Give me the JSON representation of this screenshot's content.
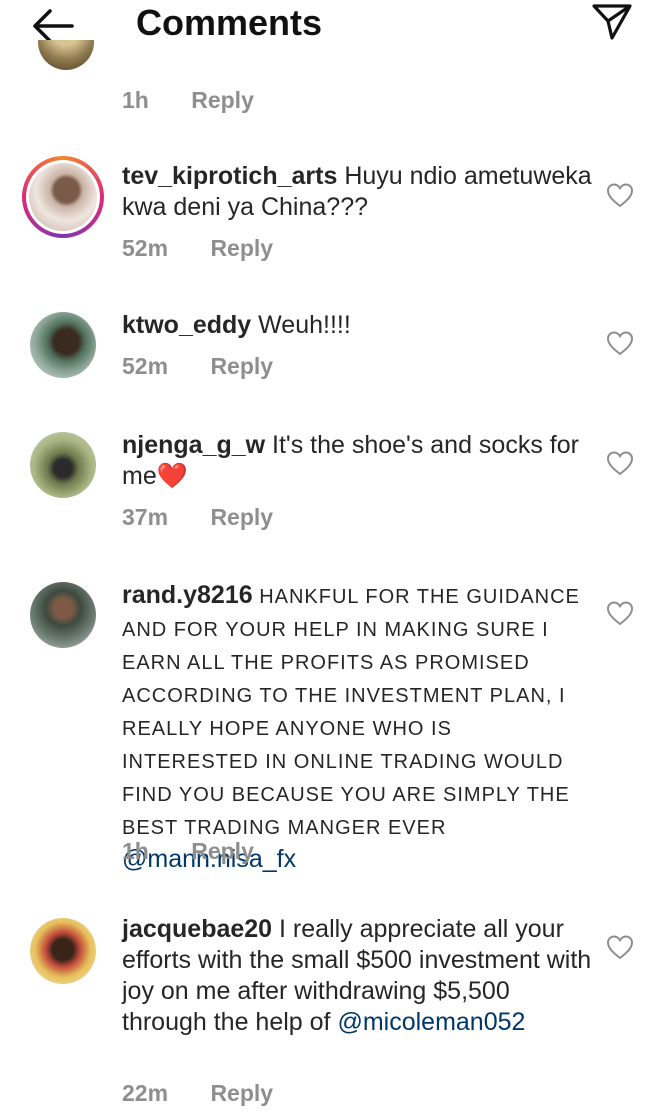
{
  "header": {
    "title": "Comments"
  },
  "partial_comment": {
    "time": "1h",
    "reply": "Reply"
  },
  "comments": [
    {
      "username": "tev_kiprotich_arts",
      "text": " Huyu ndio ametuweka kwa deni ya China???",
      "time": "52m",
      "reply": "Reply"
    },
    {
      "username": "ktwo_eddy",
      "text": " Weuh!!!!",
      "time": "52m",
      "reply": "Reply"
    },
    {
      "username": "njenga_g_w",
      "text": " It's the shoe's and socks for me",
      "emoji": "❤️",
      "time": "37m",
      "reply": "Reply"
    },
    {
      "username": "rand.y8216",
      "text": " HANKFUL FOR THE GUIDANCE AND FOR YOUR HELP IN MAKING SURE I EARN ALL THE PROFITS AS PROMISED ACCORDING TO THE INVESTMENT PLAN, I REALLY HOPE ANYONE WHO IS INTERESTED IN ONLINE TRADING WOULD FIND YOU BECAUSE YOU ARE SIMPLY THE BEST TRADING MANGER EVER ",
      "mention": "@mann.nisa_fx",
      "time": "1h",
      "reply": "Reply"
    },
    {
      "username": "jacquebae20",
      "text": " I really appreciate all your efforts with  the small $500 investment with joy on me after withdrawing $5,500 through the help of ",
      "mention": "@micoleman052",
      "time": "22m",
      "reply": "Reply"
    }
  ],
  "icons": {
    "back": "arrow-left-icon",
    "send": "paper-plane-icon",
    "like": "heart-outline-icon"
  }
}
